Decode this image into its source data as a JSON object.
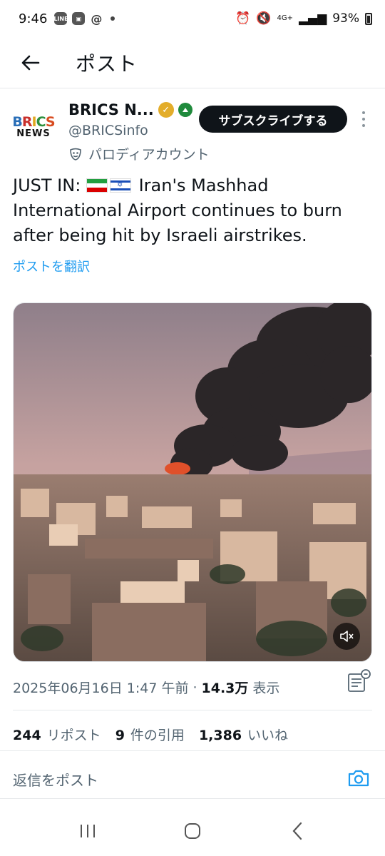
{
  "status_bar": {
    "time": "9:46",
    "network": "4G+",
    "battery": "93%"
  },
  "header": {
    "title": "ポスト"
  },
  "post": {
    "author": {
      "display_name": "BRICS N...",
      "handle": "@BRICSinfo",
      "label": "パロディアカウント",
      "avatar_line1": "BRICS",
      "avatar_line2": "NEWS"
    },
    "subscribe_label": "サブスクライブする",
    "text_prefix": "JUST IN:",
    "text_body": "Iran's Mashhad International Airport continues to burn after being hit by Israeli airstrikes.",
    "translate_label": "ポストを翻訳",
    "timestamp": "2025年06月16日 1:47 午前",
    "separator": "·",
    "views_count": "14.3万",
    "views_label": "表示",
    "stats": [
      {
        "num": "244",
        "label": "リポスト"
      },
      {
        "num": "9",
        "label": "件の引用"
      },
      {
        "num": "1,386",
        "label": "いいね"
      }
    ]
  },
  "reply": {
    "placeholder": "返信をポスト"
  },
  "colors": {
    "accent": "#1d9bf0",
    "text": "#0f1419",
    "secondary": "#536471",
    "verified_gold": "#e3ad2a"
  }
}
